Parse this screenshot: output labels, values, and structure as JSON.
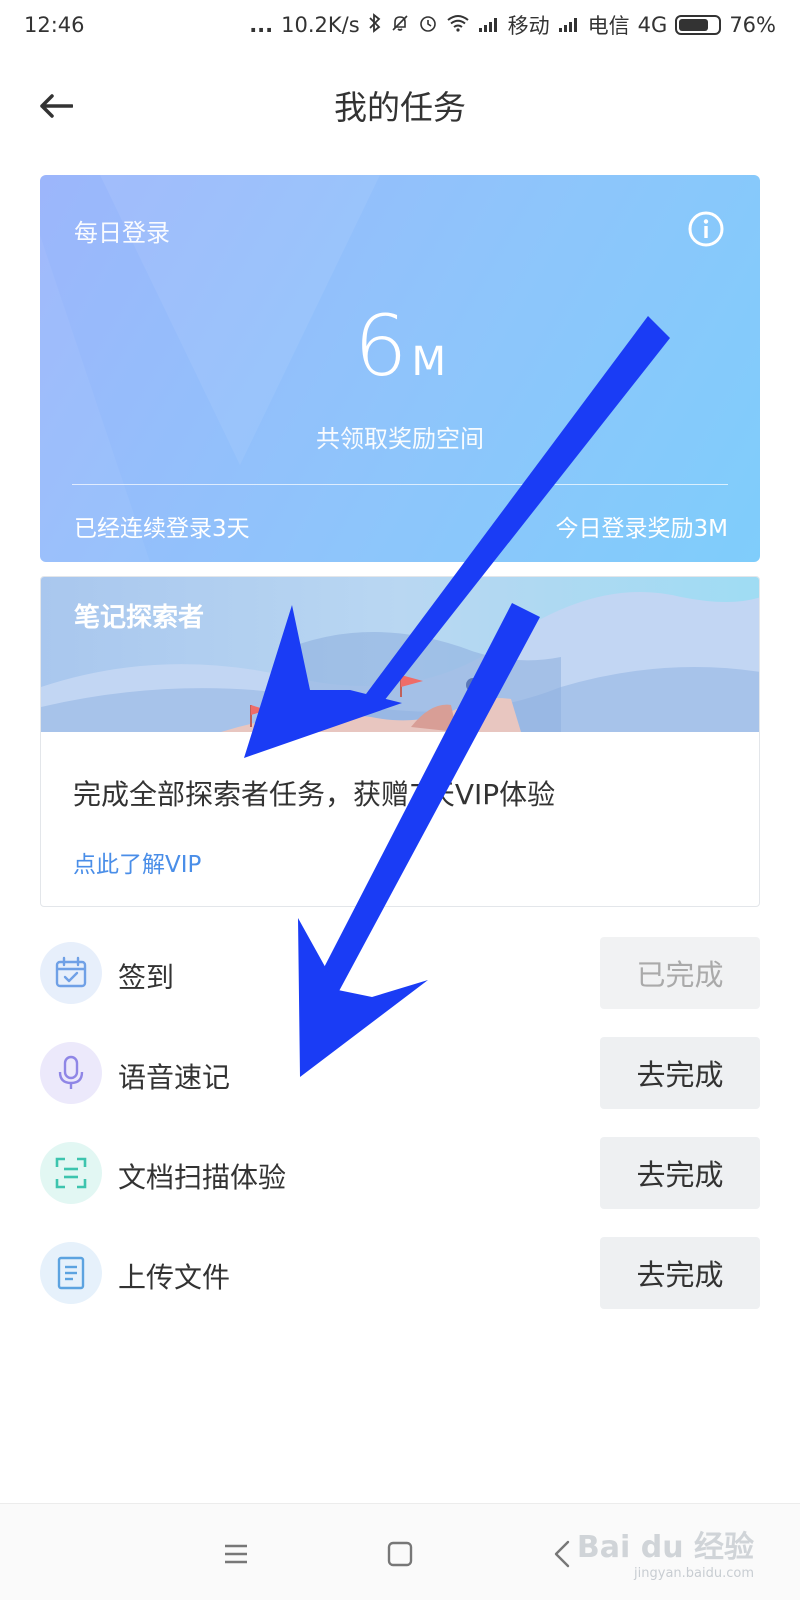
{
  "status_bar": {
    "time": "12:46",
    "dots": "...",
    "speed": "10.2K/s",
    "carrier1": "移动",
    "carrier2": "电信",
    "network": "4G",
    "battery": "76%",
    "battery_level": 0.76
  },
  "header": {
    "title": "我的任务",
    "back_icon": "arrow-left-icon"
  },
  "login_card": {
    "label": "每日登录",
    "info_icon": "info-icon",
    "amount": "6",
    "unit": "M",
    "caption": "共领取奖励空间",
    "streak": "已经连续登录3天",
    "today_reward": "今日登录奖励3M"
  },
  "explorer_card": {
    "title": "笔记探索者",
    "description": "完成全部探索者任务，获赠7天VIP体验",
    "link": "点此了解VIP"
  },
  "tasks": [
    {
      "label": "签到",
      "button": "已完成",
      "done": true,
      "icon": "calendar-check-icon"
    },
    {
      "label": "语音速记",
      "button": "去完成",
      "done": false,
      "icon": "microphone-icon"
    },
    {
      "label": "文档扫描体验",
      "button": "去完成",
      "done": false,
      "icon": "scan-icon"
    },
    {
      "label": "上传文件",
      "button": "去完成",
      "done": false,
      "icon": "document-icon"
    }
  ],
  "nav_bar": {
    "icons": [
      "menu-icon",
      "home-icon",
      "back-icon"
    ]
  },
  "watermark": {
    "main": "Bai du 经验",
    "sub": "jingyan.baidu.com"
  },
  "colors": {
    "login_card_gradient_start": "#9cb6fb",
    "login_card_gradient_end": "#7fcdfb",
    "link": "#4a8ee8",
    "arrow_overlay": "#1a3cf5"
  }
}
